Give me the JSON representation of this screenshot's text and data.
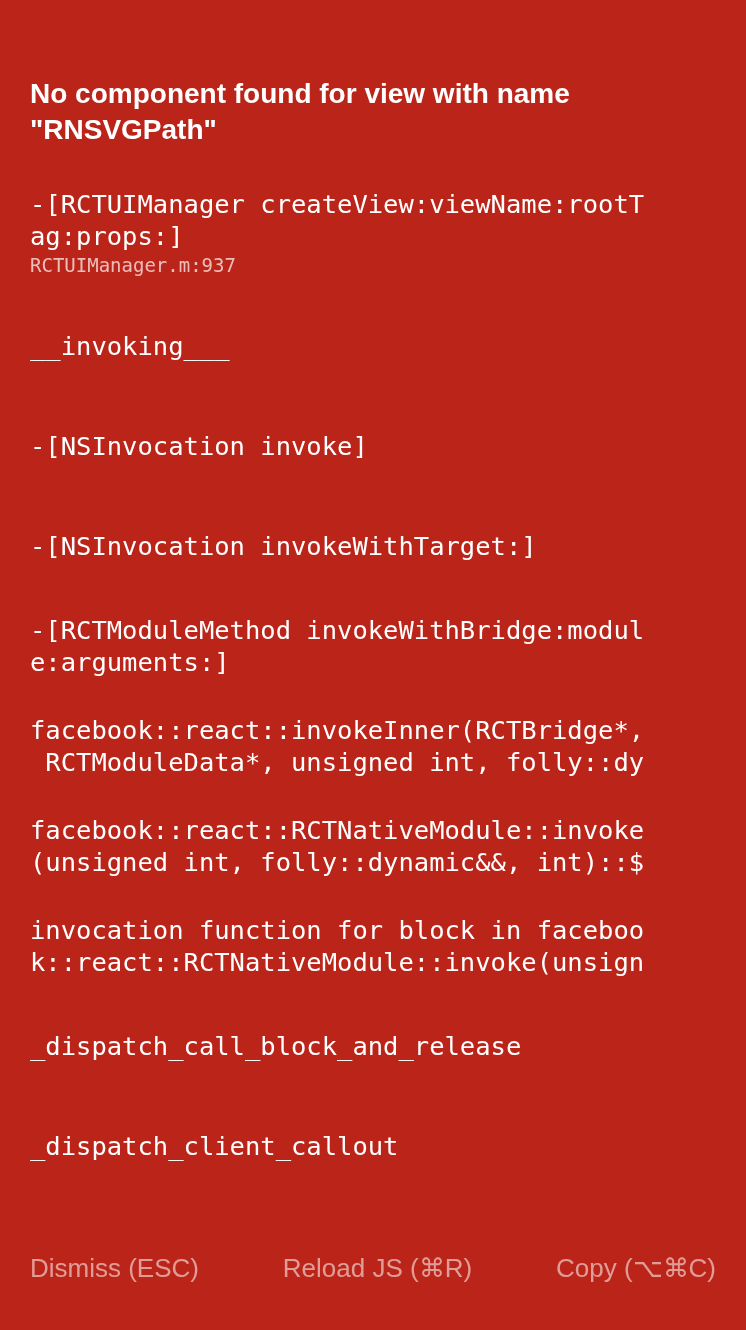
{
  "title": "No component found for view with name \"RNSVGPath\"",
  "frames": [
    {
      "lines": [
        "-[RCTUIManager createView:viewName:rootT",
        "ag:props:]"
      ],
      "file": "RCTUIManager.m:937"
    },
    {
      "lines": [
        "__invoking___"
      ]
    },
    {
      "lines": [
        "-[NSInvocation invoke]"
      ]
    },
    {
      "lines": [
        "-[NSInvocation invokeWithTarget:]"
      ]
    },
    {
      "lines": [
        "-[RCTModuleMethod invokeWithBridge:modul",
        "e:arguments:]"
      ]
    },
    {
      "lines": [
        "facebook::react::invokeInner(RCTBridge*,",
        " RCTModuleData*, unsigned int, folly::dy"
      ]
    },
    {
      "lines": [
        "facebook::react::RCTNativeModule::invoke",
        "(unsigned int, folly::dynamic&&, int)::$"
      ]
    },
    {
      "lines": [
        "invocation function for block in faceboo",
        "k::react::RCTNativeModule::invoke(unsign"
      ]
    },
    {
      "lines": [
        "_dispatch_call_block_and_release"
      ]
    },
    {
      "lines": [
        "_dispatch_client_callout"
      ]
    }
  ],
  "buttons": [
    "Dismiss (ESC)",
    "Reload JS (⌘R)",
    "Copy (⌥⌘C)"
  ]
}
